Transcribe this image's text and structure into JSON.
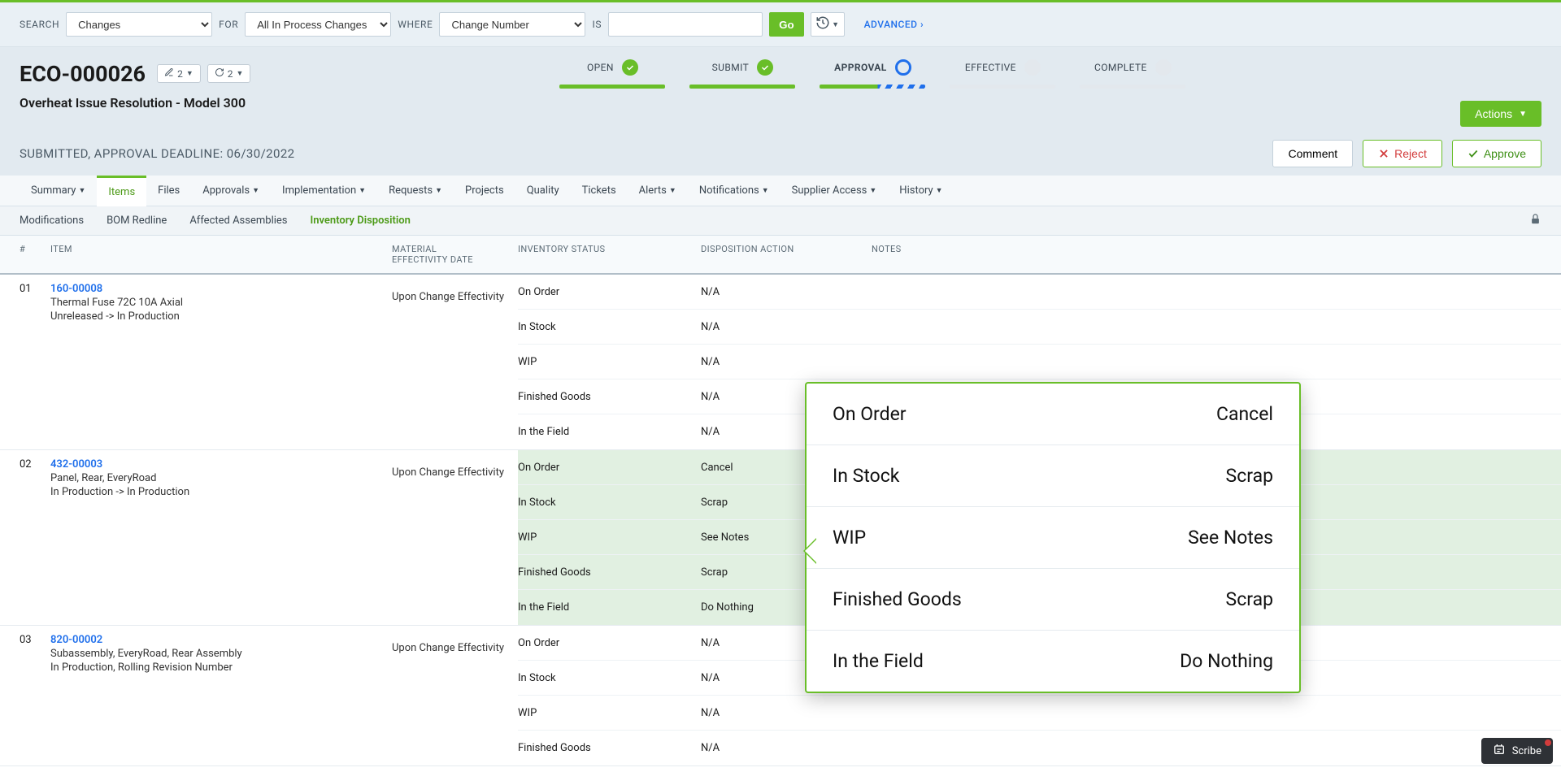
{
  "search": {
    "labels": {
      "search": "SEARCH",
      "for": "FOR",
      "where": "WHERE",
      "is": "IS"
    },
    "changes": "Changes",
    "all_in": "All In Process Changes",
    "where": "Change Number",
    "go": "Go",
    "advanced": "ADVANCED ›"
  },
  "header": {
    "id": "ECO-000026",
    "badge_edits": "2",
    "badge_links": "2",
    "title": "Overheat Issue Resolution - Model 300",
    "deadline": "SUBMITTED, APPROVAL DEADLINE: 06/30/2022",
    "actions": "Actions",
    "comment": "Comment",
    "reject": "Reject",
    "approve": "Approve"
  },
  "workflow": {
    "open": "OPEN",
    "submit": "SUBMIT",
    "approval": "APPROVAL",
    "effective": "EFFECTIVE",
    "complete": "COMPLETE"
  },
  "main_tabs": {
    "summary": "Summary",
    "items": "Items",
    "files": "Files",
    "approvals": "Approvals",
    "implementation": "Implementation",
    "requests": "Requests",
    "projects": "Projects",
    "quality": "Quality",
    "tickets": "Tickets",
    "alerts": "Alerts",
    "notifications": "Notifications",
    "supplier": "Supplier Access",
    "history": "History"
  },
  "sub_tabs": {
    "modifications": "Modifications",
    "bom_redline": "BOM Redline",
    "affected": "Affected Assemblies",
    "inventory": "Inventory Disposition"
  },
  "columns": {
    "num": "#",
    "item": "ITEM",
    "material": "MATERIAL\nEFFECTIVITY DATE",
    "inventory": "INVENTORY STATUS",
    "disposition": "DISPOSITION ACTION",
    "notes": "NOTES"
  },
  "items": [
    {
      "num": "01",
      "pn": "160-00008",
      "desc": "Thermal Fuse 72C 10A Axial",
      "lifecycle": "Unreleased -> In Production",
      "material": "Upon Change Effectivity",
      "rows": [
        {
          "inv": "On Order",
          "disp": "N/A",
          "hl": false
        },
        {
          "inv": "In Stock",
          "disp": "N/A",
          "hl": false
        },
        {
          "inv": "WIP",
          "disp": "N/A",
          "hl": false
        },
        {
          "inv": "Finished Goods",
          "disp": "N/A",
          "hl": false
        },
        {
          "inv": "In the Field",
          "disp": "N/A",
          "hl": false
        }
      ]
    },
    {
      "num": "02",
      "pn": "432-00003",
      "desc": "Panel, Rear, EveryRoad",
      "lifecycle": "In Production -> In Production",
      "material": "Upon Change Effectivity",
      "rows": [
        {
          "inv": "On Order",
          "disp": "Cancel",
          "hl": true
        },
        {
          "inv": "In Stock",
          "disp": "Scrap",
          "hl": true
        },
        {
          "inv": "WIP",
          "disp": "See Notes",
          "hl": true
        },
        {
          "inv": "Finished Goods",
          "disp": "Scrap",
          "hl": true
        },
        {
          "inv": "In the Field",
          "disp": "Do Nothing",
          "hl": true
        }
      ]
    },
    {
      "num": "03",
      "pn": "820-00002",
      "desc": "Subassembly, EveryRoad, Rear Assembly",
      "lifecycle": "In Production, Rolling Revision Number",
      "material": "Upon Change Effectivity",
      "rows": [
        {
          "inv": "On Order",
          "disp": "N/A",
          "hl": false
        },
        {
          "inv": "In Stock",
          "disp": "N/A",
          "hl": false
        },
        {
          "inv": "WIP",
          "disp": "N/A",
          "hl": false
        },
        {
          "inv": "Finished Goods",
          "disp": "N/A",
          "hl": false
        }
      ]
    }
  ],
  "callout": [
    {
      "inv": "On Order",
      "disp": "Cancel"
    },
    {
      "inv": "In Stock",
      "disp": "Scrap"
    },
    {
      "inv": "WIP",
      "disp": "See Notes"
    },
    {
      "inv": "Finished Goods",
      "disp": "Scrap"
    },
    {
      "inv": "In the Field",
      "disp": "Do Nothing"
    }
  ],
  "scribe": "Scribe"
}
